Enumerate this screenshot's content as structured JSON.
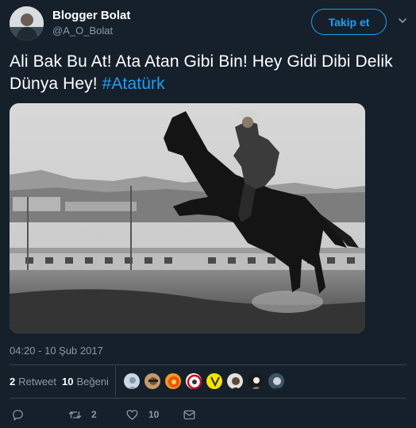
{
  "user": {
    "display_name": "Blogger Bolat",
    "handle": "@A_O_Bolat",
    "avatar_icon": "profile-avatar"
  },
  "follow_button": {
    "label": "Takip et"
  },
  "menu_icon": "chevron-down-icon",
  "tweet": {
    "text": "Ali Bak Bu At! Ata Atan Gibi Bin! Hey Gidi Dibi Delik Dünya Hey! ",
    "hashtag": "#Atatürk",
    "photo_icon": "photo-horse-rider"
  },
  "timestamp": "04:20 - 10 Şub 2017",
  "stats": {
    "retweet_count": "2",
    "retweet_label": "Retweet",
    "like_count": "10",
    "like_label": "Beğeni"
  },
  "likers_count": 8,
  "actions": {
    "reply_icon": "reply-icon",
    "retweet_icon": "retweet-icon",
    "retweet_count": "2",
    "like_icon": "heart-icon",
    "like_count": "10",
    "dm_icon": "envelope-icon"
  },
  "colors": {
    "background": "#15202b",
    "accent": "#1da1f2",
    "secondary_text": "#8899a6",
    "divider": "#38444d"
  }
}
